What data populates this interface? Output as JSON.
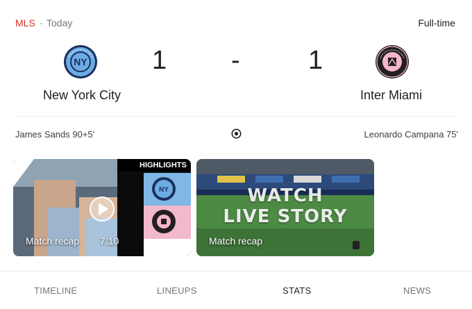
{
  "header": {
    "league": "MLS",
    "separator": "·",
    "day": "Today",
    "status": "Full-time"
  },
  "home": {
    "name": "New York City",
    "score": "1",
    "scorer": "James Sands 90+5'",
    "crest_icon": "nycfc-crest-icon"
  },
  "away": {
    "name": "Inter Miami",
    "score": "1",
    "scorer": "Leonardo Campana 75'",
    "crest_icon": "inter-miami-crest-icon"
  },
  "score_separator": "-",
  "videos": [
    {
      "label": "Match recap",
      "duration": "7:10",
      "tag": "HIGHLIGHTS",
      "play_icon": "play-icon"
    },
    {
      "label": "Match recap",
      "overlay_line_1": "WATCH",
      "overlay_line_2": "LIVE STORY",
      "icon": "story-icon"
    }
  ],
  "tabs": [
    {
      "label": "TIMELINE",
      "active": false
    },
    {
      "label": "LINEUPS",
      "active": false
    },
    {
      "label": "STATS",
      "active": true
    },
    {
      "label": "NEWS",
      "active": false
    }
  ],
  "colors": {
    "league": "#d93025",
    "muted": "#70757a",
    "text": "#202124",
    "nyc_blue": "#6cace4",
    "miami_pink": "#f7b5cd"
  }
}
